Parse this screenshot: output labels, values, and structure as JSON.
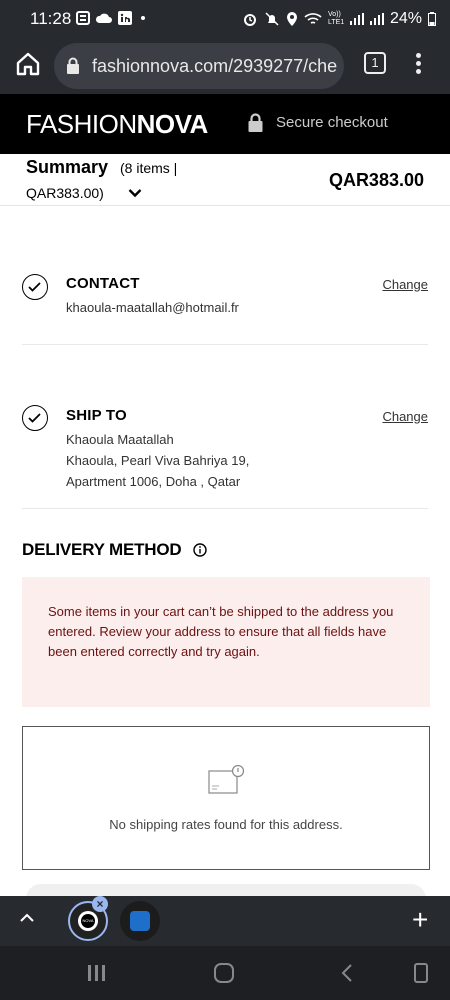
{
  "status_bar": {
    "time": "11:28",
    "battery": "24%",
    "network": "Vo)) LTE1"
  },
  "browser": {
    "url": "fashionnova.com/2939277/che",
    "tab_count": "1"
  },
  "header": {
    "logo_light": "FASHION",
    "logo_bold": "NOVA",
    "secure_label": "Secure checkout"
  },
  "summary": {
    "title": "Summary",
    "items_text": "(8 items |",
    "items_total_text": "QAR383.00)",
    "total": "QAR383.00"
  },
  "contact": {
    "title": "CONTACT",
    "email": "khaoula-maatallah@hotmail.fr",
    "change_label": "Change"
  },
  "ship_to": {
    "title": "SHIP TO",
    "name": "Khaoula Maatallah",
    "address_line1": "Khaoula, Pearl Viva Bahriya 19,",
    "address_line2": "Apartment 1006, Doha , Qatar",
    "change_label": "Change"
  },
  "delivery": {
    "title": "DELIVERY METHOD",
    "alert_text": "Some items in your cart can’t be shipped to the address you entered. Review your address to ensure that all fields have been entered correctly and try again.",
    "no_rates_text": "No shipping rates found for this address."
  },
  "colors": {
    "alert_bg": "#fdeeee",
    "alert_text": "#6b1111",
    "header_bg": "#000000",
    "browser_bg": "#272a2f"
  },
  "tab_strip": {
    "tab1_badge": "NOVA"
  }
}
